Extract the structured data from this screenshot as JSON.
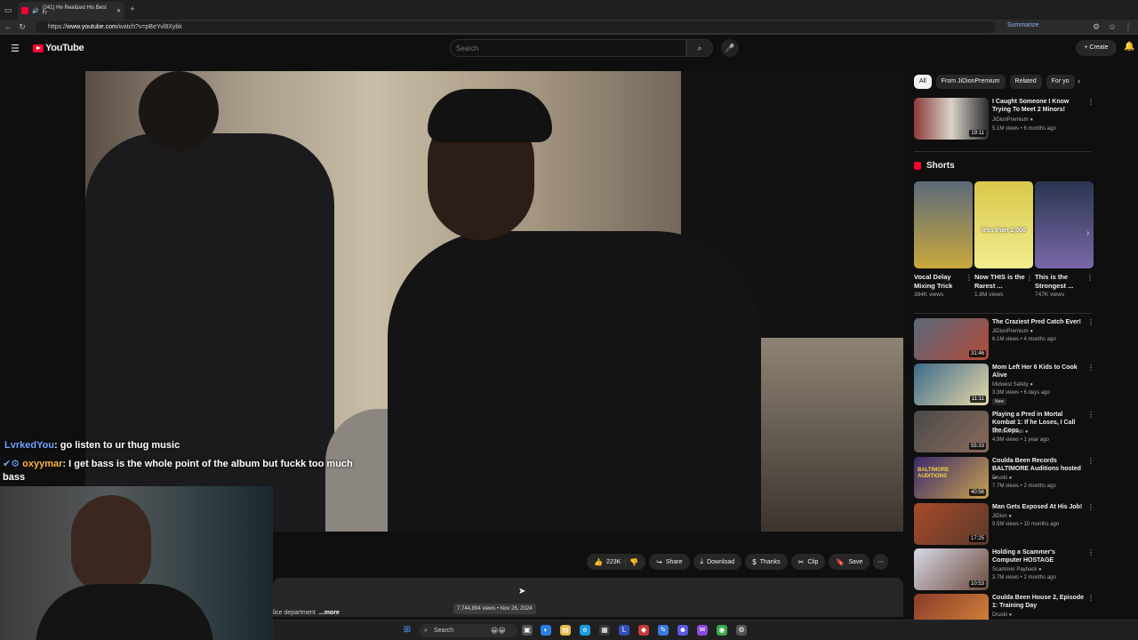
{
  "browser": {
    "tab_title": "(241) He Realized His Best Fr",
    "url_prefix": "https://",
    "url_host": "www.youtube.com",
    "url_path": "/watch?v=pBeYvl8Xybk",
    "summarize_label": "Summarize"
  },
  "youtube": {
    "logo_text": "YouTube",
    "search_placeholder": "Search",
    "create_label": "Create"
  },
  "chat": [
    {
      "user": "LvrkedYou",
      "message": ": go listen to ur thug music"
    },
    {
      "user": "oxyymar",
      "message": ": I get bass is the whole point of the album but fuckk too much"
    },
    {
      "user": "",
      "message": "bass"
    }
  ],
  "actions": {
    "likes": "223K",
    "share": "Share",
    "download": "Download",
    "thanks": "Thanks",
    "clip": "Clip",
    "save": "Save"
  },
  "description": {
    "snippet": "lice department",
    "more": "...more",
    "tooltip": "7,744,894 views • Nov 26, 2024"
  },
  "sidebar": {
    "chips": [
      "All",
      "From JiDionPremium",
      "Related",
      "For yo"
    ],
    "top_video": {
      "title": "I Caught Someone I Know Trying To Meet 2 Minors!",
      "channel": "JiDionPremium",
      "meta": "5.1M views • 6 months ago",
      "duration": "19:11",
      "colors": [
        "#8b3a3a",
        "#d9d2c8",
        "#2b2b2b"
      ]
    },
    "shorts_title": "Shorts",
    "shorts": [
      {
        "title": "Vocal Delay Mixing Trick",
        "views": "384K views",
        "colors": [
          "#5b6a7a",
          "#c9a83c"
        ]
      },
      {
        "title": "Now THIS is the Rarest ...",
        "views": "1.8M views",
        "colors": [
          "#d9c84a",
          "#f1ec8f"
        ],
        "overlay": "less than 2,000"
      },
      {
        "title": "This is the Strongest ...",
        "views": "747K views",
        "colors": [
          "#2a3550",
          "#7a68a8"
        ]
      }
    ],
    "videos": [
      {
        "title": "The Craziest Pred Catch Ever!",
        "channel": "JiDionPremium",
        "meta": "6.1M views • 4 months ago",
        "duration": "31:46",
        "colors": [
          "#5a6a7a",
          "#b24a3a"
        ]
      },
      {
        "title": "Mom Left Her 6 Kids to Cook Alive",
        "channel": "Midwest Safety",
        "meta": "3.3M views • 6 days ago",
        "badge": "New",
        "duration": "11:11",
        "colors": [
          "#3a6a8a",
          "#e8d8a8"
        ]
      },
      {
        "title": "Playing a Pred in Mortal Kombat 1: If he Loses, I Call the Cops",
        "channel": "Skeeter Jean",
        "meta": "4.9M views • 1 year ago",
        "duration": "55:33",
        "colors": [
          "#4a4a4a",
          "#8a6a5a"
        ]
      },
      {
        "title": "Coulda Been Records BALTIMORE Auditions hosted ...",
        "channel": "Druski",
        "meta": "7.7M views • 2 months ago",
        "duration": "40:56",
        "overlay": "BALTIMORE AUDITIONS",
        "colors": [
          "#3a2a6a",
          "#c8a050"
        ]
      },
      {
        "title": "Man Gets Exposed At His Job!",
        "channel": "JiDion",
        "meta": "9.5M views • 10 months ago",
        "duration": "17:25",
        "colors": [
          "#a84a2a",
          "#5a3a2a"
        ]
      },
      {
        "title": "Holding a Scammer's Computer HOSTAGE",
        "channel": "Scammer Payback",
        "meta": "3.7M views • 2 months ago",
        "duration": "10:53",
        "colors": [
          "#d8d8e8",
          "#6a4a3a"
        ]
      },
      {
        "title": "Coulda Been House 2, Episode 1: Training Day",
        "channel": "Druski",
        "meta": "",
        "duration": "",
        "colors": [
          "#8a3a2a",
          "#d88a3a"
        ]
      }
    ]
  },
  "taskbar": {
    "search_label": "Search"
  },
  "colors": {
    "accent": "#ff0033",
    "background": "#0f0f0f",
    "surface": "#272727",
    "link": "#8ab4f8"
  }
}
